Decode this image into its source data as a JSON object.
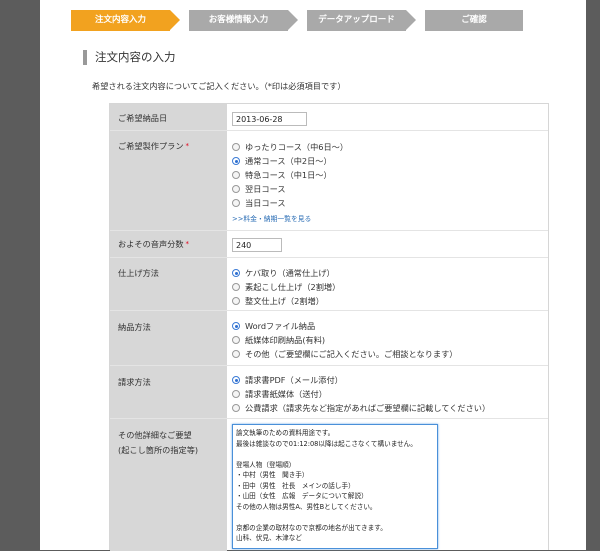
{
  "steps": [
    {
      "label": "注文内容入力",
      "active": true
    },
    {
      "label": "お客様情報入力",
      "active": false
    },
    {
      "label": "データアップロード",
      "active": false
    },
    {
      "label": "ご確認",
      "active": false
    }
  ],
  "heading": "注文内容の入力",
  "intro": "希望される注文内容についてご記入ください。（*印は必須項目です）",
  "fields": {
    "delivery_date": {
      "label": "ご希望納品日",
      "value": "2013-06-28"
    },
    "plan": {
      "label": "ご希望製作プラン",
      "required_mark": "*",
      "options": [
        "ゆったりコース（中6日〜）",
        "通常コース（中2日〜）",
        "特急コース（中1日〜）",
        "翌日コース",
        "当日コース"
      ],
      "selected": 1,
      "link": ">>料金・納期一覧を見る"
    },
    "audio_minutes": {
      "label": "およその音声分数",
      "required_mark": "*",
      "value": "240"
    },
    "finish": {
      "label": "仕上げ方法",
      "options": [
        "ケバ取り（通常仕上げ）",
        "素起こし仕上げ（2割増）",
        "整文仕上げ（2割増）"
      ],
      "selected": 0
    },
    "delivery_method": {
      "label": "納品方法",
      "options": [
        "Wordファイル納品",
        "紙媒体印刷納品(有料)",
        "その他（ご要望欄にご記入ください。ご相談となります）"
      ],
      "selected": 0
    },
    "invoice": {
      "label": "請求方法",
      "options": [
        "請求書PDF（メール添付）",
        "請求書紙媒体（送付）",
        "公費請求（請求先など指定があればご要望欄に記載してください）"
      ],
      "selected": 0
    },
    "requests": {
      "label_line1": "その他詳細なご要望",
      "label_line2": "(起こし箇所の指定等)",
      "lines": [
        "論文執筆のための資料用途です。",
        "最後は雑談なので01:12:08以降は起こさなくて構いません。",
        "",
        "登場人物（登場順）",
        "・中村（男性　聞き手）",
        "・田中（男性　社長　メインの話し手）",
        "・山田（女性　広報　データについて解説）",
        "その他の人物は男性A、男性Bとしてください。",
        "",
        "京都の企業の取材なので京都の地名が出てきます。",
        "山科、伏見、木津など"
      ]
    }
  },
  "colors": {
    "active_step": "#f2a21f",
    "inactive_step": "#a9a9a9",
    "label_bg": "#d7d7d7",
    "link": "#2a6db5",
    "required": "#e2001a"
  }
}
